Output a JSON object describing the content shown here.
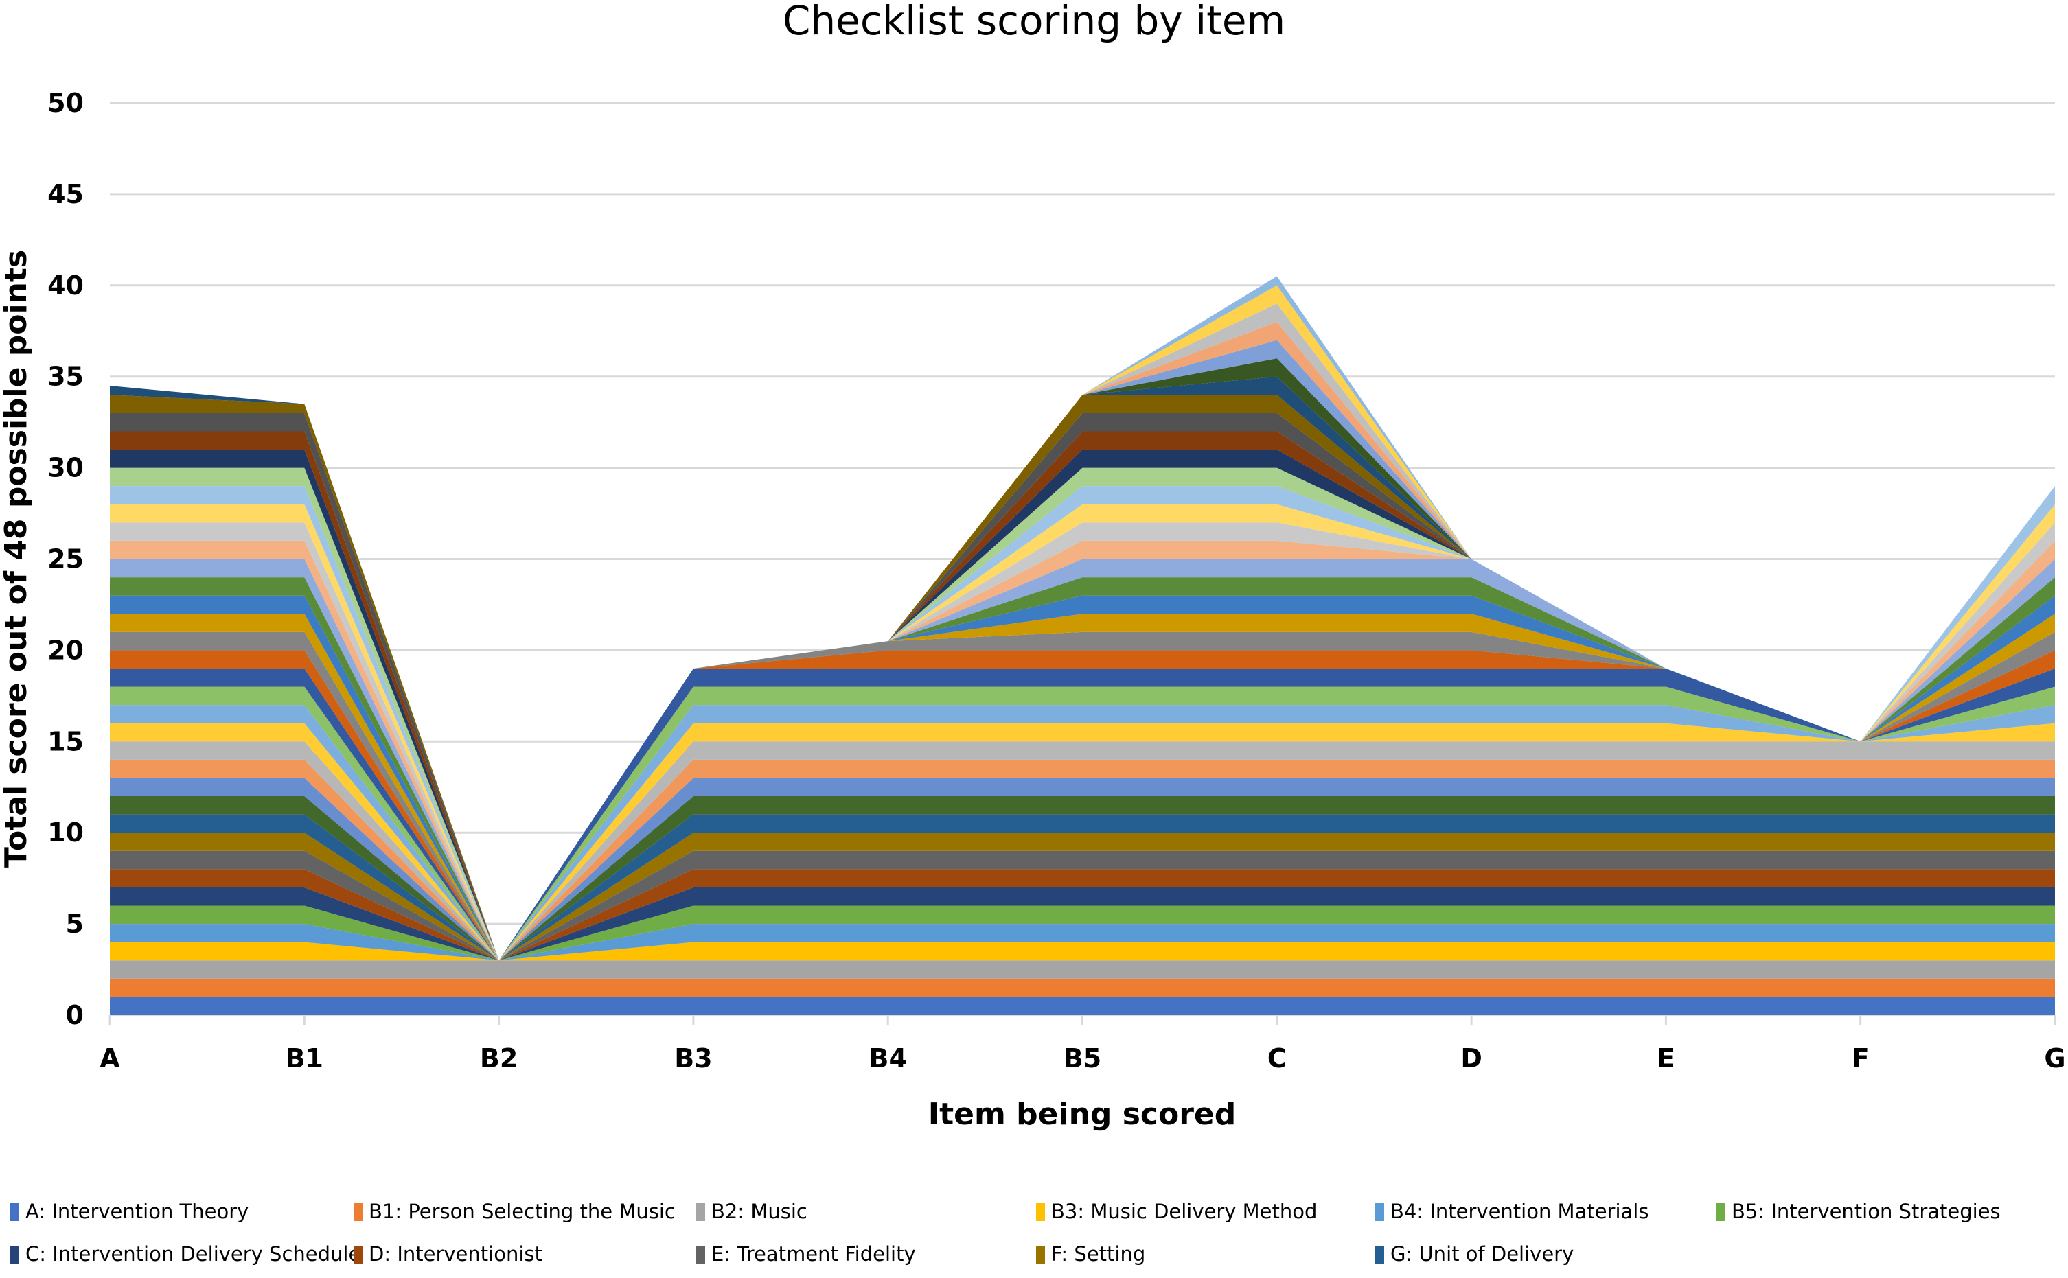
{
  "chart_data": {
    "type": "area",
    "stacked": true,
    "title": "Checklist scoring by item",
    "xlabel": "Item being scored",
    "ylabel": "Total score out of 48 possible points",
    "categories": [
      "A",
      "B1",
      "B2",
      "B3",
      "B4",
      "B5",
      "C",
      "D",
      "E",
      "F",
      "G"
    ],
    "ylim": [
      0,
      50
    ],
    "yticks": [
      0,
      5,
      10,
      15,
      20,
      25,
      30,
      35,
      40,
      45,
      50
    ],
    "grid": true,
    "legend_position": "bottom",
    "totals": [
      34.5,
      33.5,
      3,
      19,
      20.5,
      34,
      40.5,
      25,
      19,
      15,
      29
    ],
    "palette": [
      "#4472C4",
      "#ED7D31",
      "#A5A5A5",
      "#FFC000",
      "#5B9BD5",
      "#70AD47",
      "#264478",
      "#9E480E",
      "#636363",
      "#997300",
      "#255E91",
      "#43682B",
      "#698ED0",
      "#F1975A",
      "#B7B7B7",
      "#FFCD33",
      "#7CAFDD",
      "#8CC168",
      "#335AA1",
      "#D26012",
      "#848484",
      "#CC9A00",
      "#3C7CC2",
      "#5A8B39",
      "#8FAADC",
      "#F4B183",
      "#C9C9C9",
      "#FFD966",
      "#9DC3E6",
      "#A9D18E",
      "#203864",
      "#843C0C",
      "#525252",
      "#7F6000",
      "#1F4E79",
      "#385723",
      "#7F9FD8",
      "#F2A574",
      "#BFBFBF",
      "#FFD24D",
      "#8CB8E2"
    ],
    "series": [
      {
        "name": "A: Intervention Theory",
        "values": [
          1,
          1,
          1,
          1,
          1,
          1,
          1,
          1,
          1,
          1,
          1
        ]
      },
      {
        "name": "B1: Person Selecting the Music",
        "values": [
          1,
          1,
          1,
          1,
          1,
          1,
          1,
          1,
          1,
          1,
          1
        ]
      },
      {
        "name": "B2: Music",
        "values": [
          1,
          1,
          1,
          1,
          1,
          1,
          1,
          1,
          1,
          1,
          1
        ]
      },
      {
        "name": "B3: Music Delivery Method",
        "values": [
          1,
          1,
          0,
          1,
          1,
          1,
          1,
          1,
          1,
          1,
          1
        ]
      },
      {
        "name": "B4: Intervention Materials",
        "values": [
          1,
          1,
          0,
          1,
          1,
          1,
          1,
          1,
          1,
          1,
          1
        ]
      },
      {
        "name": "B5: Intervention Strategies",
        "values": [
          1,
          1,
          0,
          1,
          1,
          1,
          1,
          1,
          1,
          1,
          1
        ]
      },
      {
        "name": "C: Intervention Delivery Schedule",
        "values": [
          1,
          1,
          0,
          1,
          1,
          1,
          1,
          1,
          1,
          1,
          1
        ]
      },
      {
        "name": "D: Interventionist",
        "values": [
          1,
          1,
          0,
          1,
          1,
          1,
          1,
          1,
          1,
          1,
          1
        ]
      },
      {
        "name": "E: Treatment Fidelity",
        "values": [
          1,
          1,
          0,
          1,
          1,
          1,
          1,
          1,
          1,
          1,
          1
        ]
      },
      {
        "name": "F: Setting",
        "values": [
          1,
          1,
          0,
          1,
          1,
          1,
          1,
          1,
          1,
          1,
          1
        ]
      },
      {
        "name": "G: Unit of Delivery",
        "values": [
          1,
          1,
          0,
          1,
          1,
          1,
          1,
          1,
          1,
          1,
          1
        ]
      },
      {
        "values": [
          1,
          1,
          0,
          1,
          1,
          1,
          1,
          1,
          1,
          1,
          1
        ]
      },
      {
        "values": [
          1,
          1,
          0,
          1,
          1,
          1,
          1,
          1,
          1,
          1,
          1
        ]
      },
      {
        "values": [
          1,
          1,
          0,
          1,
          1,
          1,
          1,
          1,
          1,
          1,
          1
        ]
      },
      {
        "values": [
          1,
          1,
          0,
          1,
          1,
          1,
          1,
          1,
          1,
          1,
          1
        ]
      },
      {
        "values": [
          1,
          1,
          0,
          1,
          1,
          1,
          1,
          1,
          1,
          0,
          1
        ]
      },
      {
        "values": [
          1,
          1,
          0,
          1,
          1,
          1,
          1,
          1,
          1,
          0,
          1
        ]
      },
      {
        "values": [
          1,
          1,
          0,
          1,
          1,
          1,
          1,
          1,
          1,
          0,
          1
        ]
      },
      {
        "values": [
          1,
          1,
          0,
          1,
          1,
          1,
          1,
          1,
          1,
          0,
          1
        ]
      },
      {
        "values": [
          1,
          1,
          0,
          0,
          1,
          1,
          1,
          1,
          0,
          0,
          1
        ]
      },
      {
        "values": [
          1,
          1,
          0,
          0,
          0.5,
          1,
          1,
          1,
          0,
          0,
          1
        ]
      },
      {
        "values": [
          1,
          1,
          0,
          0,
          0,
          1,
          1,
          1,
          0,
          0,
          1
        ]
      },
      {
        "values": [
          1,
          1,
          0,
          0,
          0,
          1,
          1,
          1,
          0,
          0,
          1
        ]
      },
      {
        "values": [
          1,
          1,
          0,
          0,
          0,
          1,
          1,
          1,
          0,
          0,
          1
        ]
      },
      {
        "values": [
          1,
          1,
          0,
          0,
          0,
          1,
          1,
          1,
          0,
          0,
          1
        ]
      },
      {
        "values": [
          1,
          1,
          0,
          0,
          0,
          1,
          1,
          0,
          0,
          0,
          1
        ]
      },
      {
        "values": [
          1,
          1,
          0,
          0,
          0,
          1,
          1,
          0,
          0,
          0,
          1
        ]
      },
      {
        "values": [
          1,
          1,
          0,
          0,
          0,
          1,
          1,
          0,
          0,
          0,
          1
        ]
      },
      {
        "values": [
          1,
          1,
          0,
          0,
          0,
          1,
          1,
          0,
          0,
          0,
          1
        ]
      },
      {
        "values": [
          1,
          1,
          0,
          0,
          0,
          1,
          1,
          0,
          0,
          0,
          0
        ]
      },
      {
        "values": [
          1,
          1,
          0,
          0,
          0,
          1,
          1,
          0,
          0,
          0,
          0
        ]
      },
      {
        "values": [
          1,
          1,
          0,
          0,
          0,
          1,
          1,
          0,
          0,
          0,
          0
        ]
      },
      {
        "values": [
          1,
          1,
          0,
          0,
          0,
          1,
          1,
          0,
          0,
          0,
          0
        ]
      },
      {
        "values": [
          1,
          0.5,
          0,
          0,
          0,
          1,
          1,
          0,
          0,
          0,
          0
        ]
      },
      {
        "values": [
          0.5,
          0,
          0,
          0,
          0,
          0,
          1,
          0,
          0,
          0,
          0
        ]
      },
      {
        "values": [
          0,
          0,
          0,
          0,
          0,
          0,
          1,
          0,
          0,
          0,
          0
        ]
      },
      {
        "values": [
          0,
          0,
          0,
          0,
          0,
          0,
          1,
          0,
          0,
          0,
          0
        ]
      },
      {
        "values": [
          0,
          0,
          0,
          0,
          0,
          0,
          1,
          0,
          0,
          0,
          0
        ]
      },
      {
        "values": [
          0,
          0,
          0,
          0,
          0,
          0,
          1,
          0,
          0,
          0,
          0
        ]
      },
      {
        "values": [
          0,
          0,
          0,
          0,
          0,
          0,
          1,
          0,
          0,
          0,
          0
        ]
      },
      {
        "values": [
          0,
          0,
          0,
          0,
          0,
          0,
          0.5,
          0,
          0,
          0,
          0
        ]
      }
    ],
    "legend": [
      "A: Intervention Theory",
      "B1: Person Selecting the Music",
      "B2: Music",
      "B3: Music Delivery Method",
      "B4: Intervention Materials",
      "B5: Intervention Strategies",
      "C: Intervention Delivery Schedule",
      "D: Interventionist",
      "E: Treatment Fidelity",
      "F: Setting",
      "G: Unit of Delivery"
    ]
  }
}
